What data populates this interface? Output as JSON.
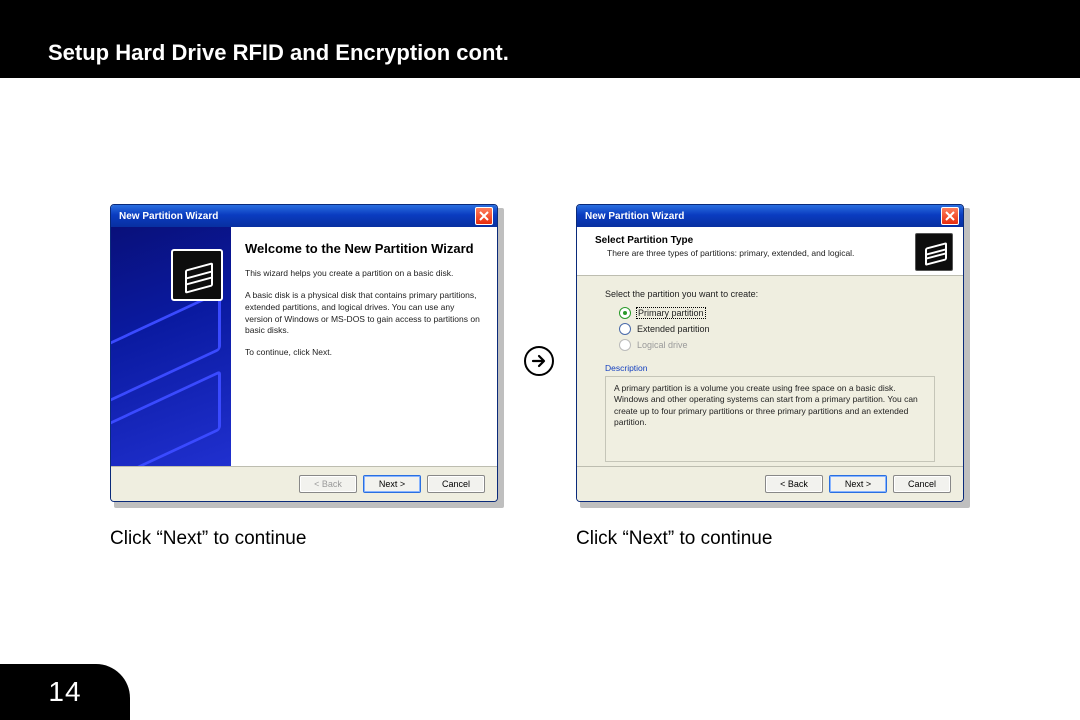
{
  "header": {
    "title": "Setup Hard Drive RFID and Encryption cont."
  },
  "page_number": "14",
  "captions": {
    "left": "Click “Next” to continue",
    "right": "Click “Next” to continue"
  },
  "wizard_left": {
    "title": "New Partition Wizard",
    "heading": "Welcome to the New Partition Wizard",
    "p1": "This wizard helps you create a partition on a basic disk.",
    "p2": "A basic disk is a physical disk that contains primary partitions, extended partitions, and logical drives. You can use any version of Windows or MS-DOS to gain access to partitions on basic disks.",
    "p3": "To continue, click Next.",
    "buttons": {
      "back": "< Back",
      "next": "Next >",
      "cancel": "Cancel"
    }
  },
  "wizard_right": {
    "title": "New Partition Wizard",
    "header_title": "Select Partition Type",
    "header_sub": "There are three types of partitions: primary, extended, and logical.",
    "prompt": "Select the partition you want to create:",
    "options": {
      "primary": "Primary partition",
      "extended": "Extended partition",
      "logical": "Logical drive"
    },
    "description_label": "Description",
    "description_text": "A primary partition is a volume you create using free space on a basic disk. Windows and other operating systems can start from a primary partition. You can create up to four primary partitions or three primary partitions and an extended partition.",
    "buttons": {
      "back": "< Back",
      "next": "Next >",
      "cancel": "Cancel"
    }
  }
}
